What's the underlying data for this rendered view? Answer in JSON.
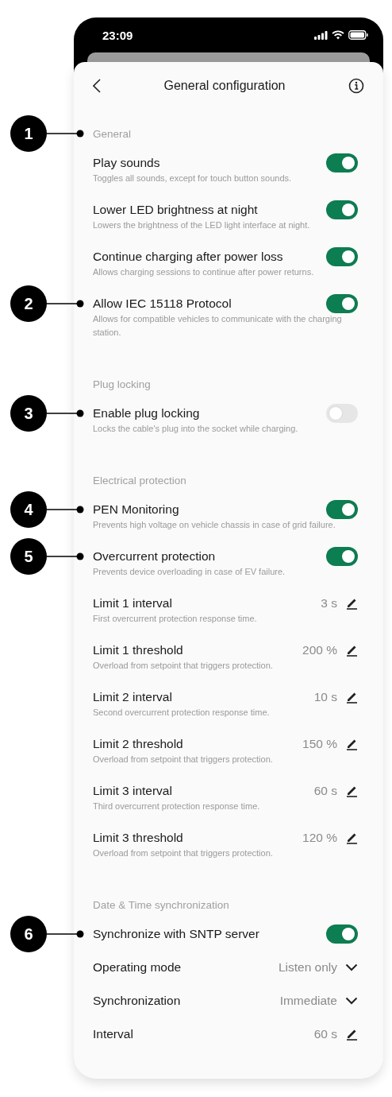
{
  "status_bar": {
    "time": "23:09"
  },
  "header": {
    "title": "General configuration"
  },
  "sections": [
    {
      "title": "General",
      "callout": "1",
      "items": [
        {
          "kind": "toggle",
          "label": "Play sounds",
          "description": "Toggles all sounds, except for touch button sounds.",
          "on": true
        },
        {
          "kind": "toggle",
          "label": "Lower LED brightness at night",
          "description": "Lowers the brightness of the LED light interface at night.",
          "on": true
        },
        {
          "kind": "toggle",
          "label": "Continue charging after power loss",
          "description": "Allows charging sessions to continue after power returns.",
          "on": true
        },
        {
          "kind": "toggle",
          "label": "Allow IEC 15118 Protocol",
          "description": "Allows for compatible vehicles to communicate with the charging station.",
          "on": true,
          "callout": "2"
        }
      ]
    },
    {
      "title": "Plug locking",
      "items": [
        {
          "kind": "toggle",
          "label": "Enable plug locking",
          "description": "Locks the cable's plug into the socket while charging.",
          "on": false,
          "callout": "3"
        }
      ]
    },
    {
      "title": "Electrical protection",
      "items": [
        {
          "kind": "toggle",
          "label": "PEN Monitoring",
          "description": "Prevents high voltage on vehicle chassis in case of grid failure.",
          "on": true,
          "callout": "4"
        },
        {
          "kind": "toggle",
          "label": "Overcurrent protection",
          "description": "Prevents device overloading in case of EV failure.",
          "on": true,
          "callout": "5"
        },
        {
          "kind": "edit",
          "label": "Limit 1 interval",
          "description": "First overcurrent protection response time.",
          "value": "3 s"
        },
        {
          "kind": "edit",
          "label": "Limit 1 threshold",
          "description": "Overload from setpoint that triggers protection.",
          "value": "200 %"
        },
        {
          "kind": "edit",
          "label": "Limit 2 interval",
          "description": "Second overcurrent protection response time.",
          "value": "10 s"
        },
        {
          "kind": "edit",
          "label": "Limit 2 threshold",
          "description": "Overload from setpoint that triggers protection.",
          "value": "150 %"
        },
        {
          "kind": "edit",
          "label": "Limit 3 interval",
          "description": "Third overcurrent protection response time.",
          "value": "60 s"
        },
        {
          "kind": "edit",
          "label": "Limit 3 threshold",
          "description": "Overload from setpoint that triggers protection.",
          "value": "120 %"
        }
      ]
    },
    {
      "title": "Date & Time synchronization",
      "items": [
        {
          "kind": "toggle",
          "label": "Synchronize with SNTP server",
          "on": true,
          "callout": "6"
        },
        {
          "kind": "select",
          "label": "Operating mode",
          "value": "Listen only"
        },
        {
          "kind": "select",
          "label": "Synchronization",
          "value": "Immediate"
        },
        {
          "kind": "edit",
          "label": "Interval",
          "value": "60 s"
        }
      ]
    }
  ]
}
